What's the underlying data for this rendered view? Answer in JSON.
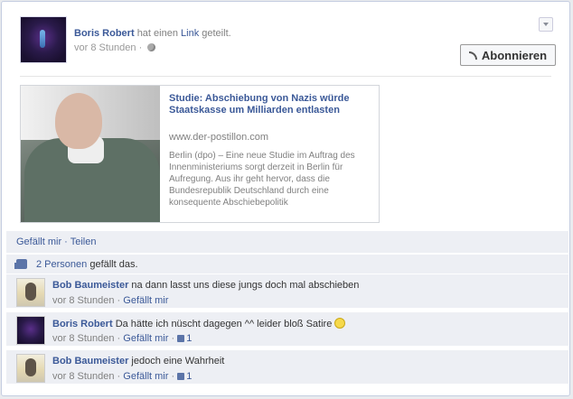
{
  "post": {
    "author": "Boris Robert",
    "action_prefix": "hat einen",
    "action_link": "Link",
    "action_suffix": "geteilt.",
    "time": "vor 8 Stunden",
    "meta_sep": "·",
    "subscribe_label": "Abonnieren"
  },
  "share": {
    "title": "Studie: Abschiebung von Nazis würde Staatskasse um Milliarden entlasten",
    "url": "www.der-postillon.com",
    "description": "Berlin (dpo) – Eine neue Studie im Auftrag des Innenministeriums sorgt derzeit in Berlin für Aufregung. Aus ihr geht hervor, dass die Bundesrepublik Deutschland durch eine konsequente Abschiebepolitik"
  },
  "actions": {
    "like": "Gefällt mir",
    "sep": " · ",
    "share": "Teilen"
  },
  "likes": {
    "count_link": "2 Personen",
    "suffix": "gefällt das."
  },
  "comments": [
    {
      "author": "Bob Baumeister",
      "text": "na dann lasst uns diese jungs doch mal abschieben",
      "time": "vor 8 Stunden",
      "like_label": "Gefällt mir",
      "likes": ""
    },
    {
      "author": "Boris Robert",
      "text": "Da hätte ich nüscht dagegen ^^ leider bloß Satire",
      "time": "vor 8 Stunden",
      "like_label": "Gefällt mir",
      "likes": "1"
    },
    {
      "author": "Bob Baumeister",
      "text": "jedoch eine Wahrheit",
      "time": "vor 8 Stunden",
      "like_label": "Gefällt mir",
      "likes": "1"
    }
  ],
  "colors": {
    "link": "#3b5998",
    "panel": "#edeff4"
  }
}
